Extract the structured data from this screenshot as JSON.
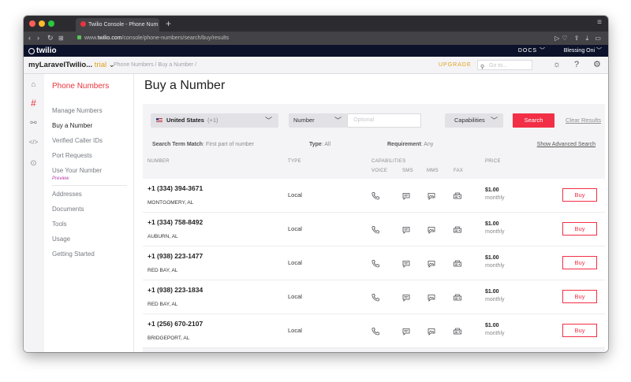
{
  "browser": {
    "tab_title": "Twilio Console - Phone Num",
    "url_prefix": "www.",
    "url_domain": "twilio.com",
    "url_path": "/console/phone-numbers/search/buy/results"
  },
  "appbar": {
    "logo": "twilio",
    "docs": "DOCS",
    "user": "Blessing Oni"
  },
  "project": {
    "name": "myLaravelTwilio...",
    "trial": "trial",
    "breadcrumb": "Phone Numbers / Buy a Number /",
    "upgrade": "UPGRADE",
    "goto_placeholder": "Go to..."
  },
  "subnav": {
    "title": "Phone Numbers",
    "items": [
      "Manage Numbers",
      "Buy a Number",
      "Verified Caller IDs",
      "Port Requests",
      "Use Your Number",
      "Addresses",
      "Documents",
      "Tools",
      "Usage",
      "Getting Started"
    ],
    "preview": "Preview"
  },
  "page": {
    "title": "Buy a Number"
  },
  "search": {
    "country": "United States",
    "country_code": "(+1)",
    "mode": "Number",
    "placeholder": "Optional",
    "capabilities": "Capabilities",
    "search_label": "Search",
    "clear_label": "Clear Results"
  },
  "meta": {
    "match_label": "Search Term Match",
    "match_value": ": First part of number",
    "type_label": "Type",
    "type_value": ": All",
    "req_label": "Requirement",
    "req_value": ": Any",
    "advanced": "Show Advanced Search"
  },
  "columns": {
    "number": "NUMBER",
    "type": "TYPE",
    "capabilities": "CAPABILITIES",
    "voice": "VOICE",
    "sms": "SMS",
    "mms": "MMS",
    "fax": "FAX",
    "price": "PRICE"
  },
  "results": [
    {
      "number": "+1 (334) 394-3671",
      "city": "MONTGOMERY, AL",
      "type": "Local",
      "price": "$1.00",
      "period": "monthly",
      "buy": "Buy"
    },
    {
      "number": "+1 (334) 758-8492",
      "city": "AUBURN, AL",
      "type": "Local",
      "price": "$1.00",
      "period": "monthly",
      "buy": "Buy"
    },
    {
      "number": "+1 (938) 223-1477",
      "city": "RED BAY, AL",
      "type": "Local",
      "price": "$1.00",
      "period": "monthly",
      "buy": "Buy"
    },
    {
      "number": "+1 (938) 223-1834",
      "city": "RED BAY, AL",
      "type": "Local",
      "price": "$1.00",
      "period": "monthly",
      "buy": "Buy"
    },
    {
      "number": "+1 (256) 670-2107",
      "city": "BRIDGEPORT, AL",
      "type": "Local",
      "price": "$1.00",
      "period": "monthly",
      "buy": "Buy"
    }
  ],
  "icons": {
    "voice": "phone-icon",
    "sms": "message-icon",
    "mms": "image-message-icon",
    "fax": "fax-icon"
  },
  "colors": {
    "brand_red": "#f22f46",
    "app_bar": "#0d122b",
    "trial": "#e2a019"
  }
}
